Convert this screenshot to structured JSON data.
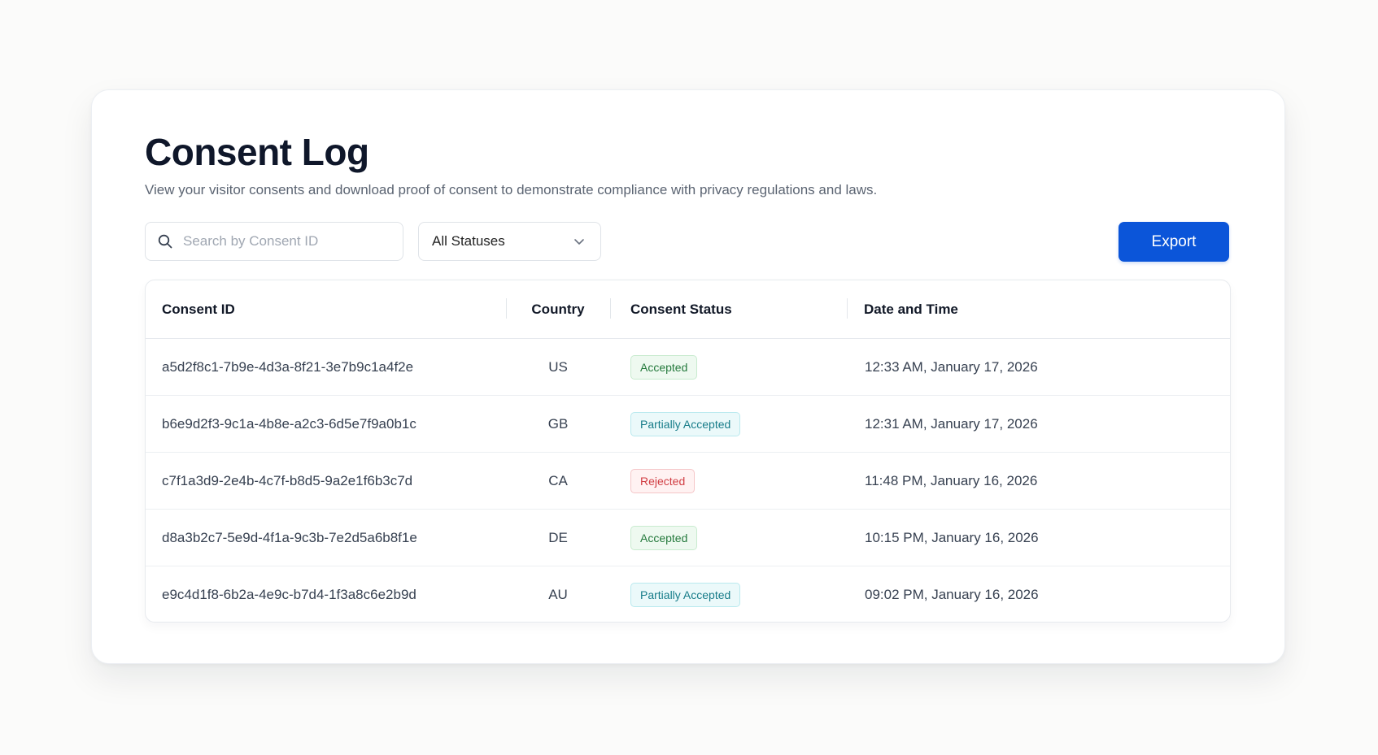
{
  "page": {
    "title": "Consent Log",
    "subtitle": "View your visitor consents and download proof of consent to demonstrate compliance with privacy regulations and laws."
  },
  "toolbar": {
    "search_placeholder": "Search by Consent ID",
    "status_filter": "All Statuses",
    "export_label": "Export"
  },
  "table": {
    "headers": [
      "Consent ID",
      "Country",
      "Consent Status",
      "Date and Time"
    ],
    "rows": [
      {
        "id": "a5d2f8c1-7b9e-4d3a-8f21-3e7b9c1a4f2e",
        "country": "US",
        "status": "Accepted",
        "status_type": "accepted",
        "datetime": "12:33 AM, January 17, 2026"
      },
      {
        "id": "b6e9d2f3-9c1a-4b8e-a2c3-6d5e7f9a0b1c",
        "country": "GB",
        "status": "Partially Accepted",
        "status_type": "partial",
        "datetime": "12:31 AM, January 17, 2026"
      },
      {
        "id": "c7f1a3d9-2e4b-4c7f-b8d5-9a2e1f6b3c7d",
        "country": "CA",
        "status": "Rejected",
        "status_type": "rejected",
        "datetime": "11:48 PM, January 16, 2026"
      },
      {
        "id": "d8a3b2c7-5e9d-4f1a-9c3b-7e2d5a6b8f1e",
        "country": "DE",
        "status": "Accepted",
        "status_type": "accepted",
        "datetime": "10:15 PM, January 16, 2026"
      },
      {
        "id": "e9c4d1f8-6b2a-4e9c-b7d4-1f3a8c6e2b9d",
        "country": "AU",
        "status": "Partially Accepted",
        "status_type": "partial",
        "datetime": "09:02 PM, January 16, 2026"
      }
    ]
  },
  "colors": {
    "accent": "#0b55d9",
    "status": {
      "accepted": {
        "bg": "#eef9f0",
        "border": "#c8ebcf",
        "text": "#257a3d"
      },
      "partial": {
        "bg": "#ebf9fa",
        "border": "#b9e9ee",
        "text": "#177c89"
      },
      "rejected": {
        "bg": "#fff2f2",
        "border": "#f5c6c8",
        "text": "#d13d43"
      }
    }
  },
  "icons": {
    "search": "search-icon",
    "dropdown": "chevron-down-icon"
  }
}
